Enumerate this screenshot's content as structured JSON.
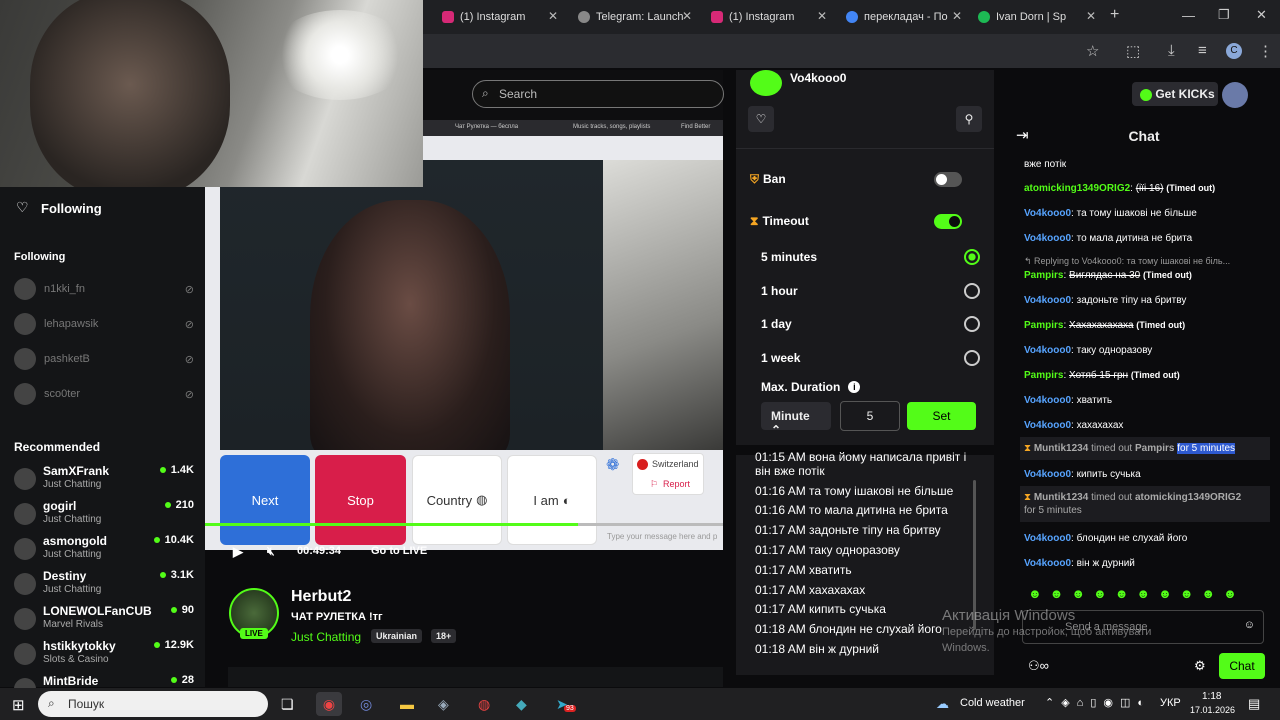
{
  "browser": {
    "tabs": [
      {
        "label": "(1) Instagram",
        "color": "#d62976"
      },
      {
        "label": "Telegram: Launch",
        "color": "#888888"
      },
      {
        "label": "(1) Instagram",
        "color": "#d62976"
      },
      {
        "label": "перекладач - По",
        "color": "#4285f4"
      },
      {
        "label": "Ivan Dorn | Sp",
        "color": "#1db954"
      }
    ],
    "new_tab": "+",
    "profile_initial": "C"
  },
  "site_search": {
    "placeholder": "Search"
  },
  "left_nav": {
    "following_header": "Following",
    "following_section": "Following",
    "following": [
      {
        "name": "n1kki_fn"
      },
      {
        "name": "lehapawsik"
      },
      {
        "name": "pashketB"
      },
      {
        "name": "sco0ter"
      }
    ],
    "recommended_header": "Recommended",
    "recommended": [
      {
        "name": "SamXFrank",
        "category": "Just Chatting",
        "viewers": "1.4K"
      },
      {
        "name": "gogirl",
        "category": "Just Chatting",
        "viewers": "210"
      },
      {
        "name": "asmongold",
        "category": "Just Chatting",
        "viewers": "10.4K"
      },
      {
        "name": "Destiny",
        "category": "Just Chatting",
        "viewers": "3.1K"
      },
      {
        "name": "LONEWOLFanCUB",
        "category": "Marvel Rivals",
        "viewers": "90"
      },
      {
        "name": "hstikkytokky",
        "category": "Slots & Casino",
        "viewers": "12.9K"
      },
      {
        "name": "MintBride",
        "category": "",
        "viewers": "28"
      }
    ]
  },
  "video": {
    "buttons": {
      "next": "Next",
      "stop": "Stop",
      "country": "Country",
      "iam": "I am"
    },
    "popup": {
      "country": "Switzerland",
      "report": "Report"
    },
    "message_placeholder": "Type your message here and p",
    "progress": 0.72,
    "time": "00:49:34",
    "go_live": "Go to LIVE",
    "inner_tabs": [
      "Чат Рулетка — беспла",
      "Music tracks, songs, playlists",
      "Find Better"
    ]
  },
  "streamer": {
    "name": "Herbut2",
    "title": "ЧАТ РУЛЕТКА !тг",
    "category": "Just Chatting",
    "tags": [
      "Ukrainian",
      "18+"
    ],
    "live_badge": "LIVE"
  },
  "mod_panel": {
    "username": "Vo4kooo0",
    "ban_label": "Ban",
    "ban_on": false,
    "timeout_label": "Timeout",
    "timeout_on": true,
    "durations": [
      {
        "label": "5 minutes",
        "selected": true
      },
      {
        "label": "1 hour",
        "selected": false
      },
      {
        "label": "1 day",
        "selected": false
      },
      {
        "label": "1 week",
        "selected": false
      }
    ],
    "max_duration_label": "Max. Duration",
    "unit": "Minute",
    "value": "5",
    "set_label": "Set",
    "log": [
      "01:15 AM вона йому написала привіт і",
      "він вже потік",
      "01:16 AM та тому ішакові не більше",
      "01:16 AM то мала дитина не брита",
      "01:17 AM задоньте тіпу на бритву",
      "01:17 AM таку одноразову",
      "01:17 AM хватить",
      "01:17 AM хахахахах",
      "01:17 AM кипить сучька",
      "01:18 AM блондин не слухай його",
      "01:18 AM він ж дурний"
    ]
  },
  "chat": {
    "get_kicks": "Get KICKs",
    "title": "Chat",
    "messages": [
      {
        "user": "",
        "text": "вже потік"
      },
      {
        "user": "atomicking1349ORIG2",
        "text": "(іїі 16)",
        "timed_out": "(Timed out)"
      },
      {
        "user": "Vo4kooo0",
        "text": "та тому ішакові не більше"
      },
      {
        "user": "Vo4kooo0",
        "text": "то мала дитина не брита"
      },
      {
        "reply": "Replying to Vo4kooo0: та тому ішакові не біль...",
        "user": "Pampirs",
        "text": "Виглядає на 30",
        "timed_out": "(Timed out)"
      },
      {
        "user": "Vo4kooo0",
        "text": "задоньте тіпу на бритву"
      },
      {
        "user": "Pampirs",
        "text": "Хахахахахаха",
        "timed_out": "(Timed out)"
      },
      {
        "user": "Vo4kooo0",
        "text": "таку одноразову"
      },
      {
        "user": "Pampirs",
        "text": "Хотяб 15 грн",
        "timed_out": "(Timed out)"
      },
      {
        "user": "Vo4kooo0",
        "text": "хватить"
      },
      {
        "user": "Vo4kooo0",
        "text": "хахахахах"
      },
      {
        "system": true,
        "mod": "Muntik1234",
        "action": "timed out",
        "target": "Pampirs",
        "duration": "for 5 minutes"
      },
      {
        "user": "Vo4kooo0",
        "text": "кипить сучька"
      },
      {
        "system": true,
        "mod": "Muntik1234",
        "action": "timed out",
        "target": "atomicking1349ORIG2",
        "duration": "for 5 minutes"
      },
      {
        "user": "Vo4kooo0",
        "text": "блондин не слухай його"
      },
      {
        "user": "Vo4kooo0",
        "text": "він ж дурний"
      }
    ],
    "input_placeholder": "Send a message",
    "send_label": "Chat"
  },
  "watermark": {
    "title": "Активація Windows",
    "line1": "Перейдіть до настройок, щоб активувати",
    "line2": "Windows."
  },
  "taskbar": {
    "search_placeholder": "Пошук",
    "weather": "Cold weather",
    "lang": "УКР",
    "time": "1:18",
    "date": "17.01.2026",
    "badge": "93"
  }
}
